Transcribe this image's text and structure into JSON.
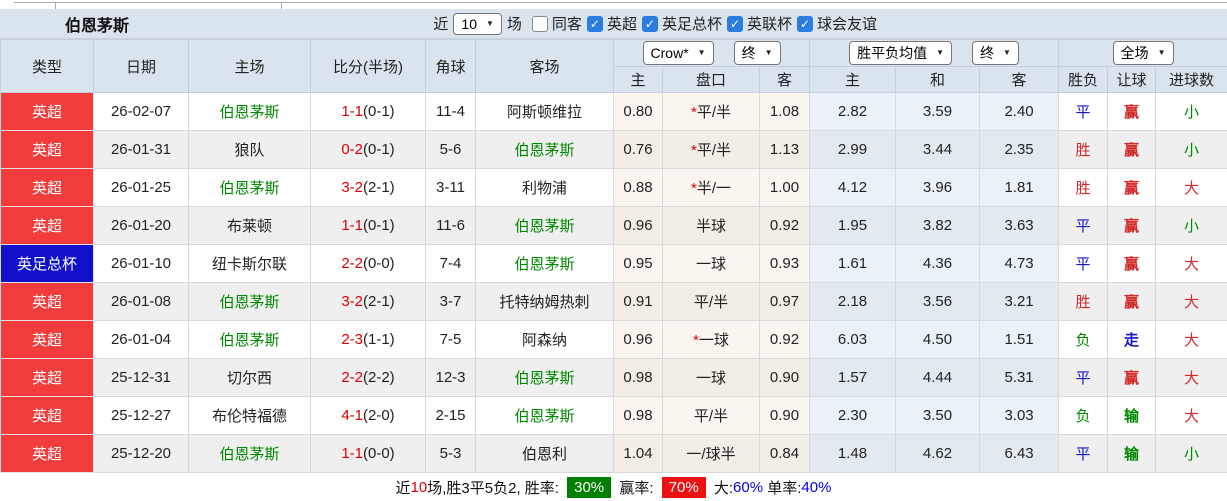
{
  "title": "伯恩茅斯",
  "filters": {
    "near_label": "近",
    "matches_value": "10",
    "matches_label": "场",
    "checkboxes": [
      {
        "label": "同客",
        "checked": false
      },
      {
        "label": "英超",
        "checked": true
      },
      {
        "label": "英足总杯",
        "checked": true
      },
      {
        "label": "英联杯",
        "checked": true
      },
      {
        "label": "球会友谊",
        "checked": true
      }
    ]
  },
  "header": {
    "selects": {
      "odds_company": "Crow*",
      "odds_final": "终",
      "avg": "胜平负均值",
      "avg_final": "终",
      "fullmatch": "全场"
    },
    "columns_main": [
      "类型",
      "日期",
      "主场",
      "比分(半场)",
      "角球",
      "客场"
    ],
    "columns_sub": [
      "主",
      "盘口",
      "客",
      "主",
      "和",
      "客",
      "胜负",
      "让球",
      "进球数"
    ]
  },
  "rows": [
    {
      "type": "英超",
      "type_color": "red",
      "date": "26-02-07",
      "home": "伯恩茅斯",
      "home_self": true,
      "score": "1-1",
      "half": "(0-1)",
      "corners": "11-4",
      "away": "阿斯顿维拉",
      "away_self": false,
      "crow": {
        "home": "0.80",
        "star": true,
        "handicap": "平/半",
        "away": "1.08"
      },
      "avg": {
        "home": "2.82",
        "draw": "3.59",
        "away": "2.40"
      },
      "result": {
        "text": "平",
        "color": "blue"
      },
      "handicap_result": {
        "text": "赢",
        "color": "red"
      },
      "goals": {
        "text": "小",
        "color": "green"
      }
    },
    {
      "type": "英超",
      "type_color": "red",
      "date": "26-01-31",
      "home": "狼队",
      "home_self": false,
      "score": "0-2",
      "half": "(0-1)",
      "corners": "5-6",
      "away": "伯恩茅斯",
      "away_self": true,
      "crow": {
        "home": "0.76",
        "star": true,
        "handicap": "平/半",
        "away": "1.13"
      },
      "avg": {
        "home": "2.99",
        "draw": "3.44",
        "away": "2.35"
      },
      "result": {
        "text": "胜",
        "color": "red"
      },
      "handicap_result": {
        "text": "赢",
        "color": "red"
      },
      "goals": {
        "text": "小",
        "color": "green"
      }
    },
    {
      "type": "英超",
      "type_color": "red",
      "date": "26-01-25",
      "home": "伯恩茅斯",
      "home_self": true,
      "score": "3-2",
      "half": "(2-1)",
      "corners": "3-11",
      "away": "利物浦",
      "away_self": false,
      "crow": {
        "home": "0.88",
        "star": true,
        "handicap": "半/一",
        "away": "1.00"
      },
      "avg": {
        "home": "4.12",
        "draw": "3.96",
        "away": "1.81"
      },
      "result": {
        "text": "胜",
        "color": "red"
      },
      "handicap_result": {
        "text": "赢",
        "color": "red"
      },
      "goals": {
        "text": "大",
        "color": "red"
      }
    },
    {
      "type": "英超",
      "type_color": "red",
      "date": "26-01-20",
      "home": "布莱顿",
      "home_self": false,
      "score": "1-1",
      "half": "(0-1)",
      "corners": "11-6",
      "away": "伯恩茅斯",
      "away_self": true,
      "crow": {
        "home": "0.96",
        "star": false,
        "handicap": "半球",
        "away": "0.92"
      },
      "avg": {
        "home": "1.95",
        "draw": "3.82",
        "away": "3.63"
      },
      "result": {
        "text": "平",
        "color": "blue"
      },
      "handicap_result": {
        "text": "赢",
        "color": "red"
      },
      "goals": {
        "text": "小",
        "color": "green"
      }
    },
    {
      "type": "英足总杯",
      "type_color": "blue",
      "date": "26-01-10",
      "home": "纽卡斯尔联",
      "home_self": false,
      "score": "2-2",
      "half": "(0-0)",
      "corners": "7-4",
      "away": "伯恩茅斯",
      "away_self": true,
      "crow": {
        "home": "0.95",
        "star": false,
        "handicap": "一球",
        "away": "0.93"
      },
      "avg": {
        "home": "1.61",
        "draw": "4.36",
        "away": "4.73"
      },
      "result": {
        "text": "平",
        "color": "blue"
      },
      "handicap_result": {
        "text": "赢",
        "color": "red"
      },
      "goals": {
        "text": "大",
        "color": "red"
      }
    },
    {
      "type": "英超",
      "type_color": "red",
      "date": "26-01-08",
      "home": "伯恩茅斯",
      "home_self": true,
      "score": "3-2",
      "half": "(2-1)",
      "corners": "3-7",
      "away": "托特纳姆热刺",
      "away_self": false,
      "crow": {
        "home": "0.91",
        "star": false,
        "handicap": "平/半",
        "away": "0.97"
      },
      "avg": {
        "home": "2.18",
        "draw": "3.56",
        "away": "3.21"
      },
      "result": {
        "text": "胜",
        "color": "red"
      },
      "handicap_result": {
        "text": "赢",
        "color": "red"
      },
      "goals": {
        "text": "大",
        "color": "red"
      }
    },
    {
      "type": "英超",
      "type_color": "red",
      "date": "26-01-04",
      "home": "伯恩茅斯",
      "home_self": true,
      "score": "2-3",
      "half": "(1-1)",
      "corners": "7-5",
      "away": "阿森纳",
      "away_self": false,
      "crow": {
        "home": "0.96",
        "star": true,
        "handicap": "一球",
        "away": "0.92"
      },
      "avg": {
        "home": "6.03",
        "draw": "4.50",
        "away": "1.51"
      },
      "result": {
        "text": "负",
        "color": "green"
      },
      "handicap_result": {
        "text": "走",
        "color": "blue"
      },
      "goals": {
        "text": "大",
        "color": "red"
      }
    },
    {
      "type": "英超",
      "type_color": "red",
      "date": "25-12-31",
      "home": "切尔西",
      "home_self": false,
      "score": "2-2",
      "half": "(2-2)",
      "corners": "12-3",
      "away": "伯恩茅斯",
      "away_self": true,
      "crow": {
        "home": "0.98",
        "star": false,
        "handicap": "一球",
        "away": "0.90"
      },
      "avg": {
        "home": "1.57",
        "draw": "4.44",
        "away": "5.31"
      },
      "result": {
        "text": "平",
        "color": "blue"
      },
      "handicap_result": {
        "text": "赢",
        "color": "red"
      },
      "goals": {
        "text": "大",
        "color": "red"
      }
    },
    {
      "type": "英超",
      "type_color": "red",
      "date": "25-12-27",
      "home": "布伦特福德",
      "home_self": false,
      "score": "4-1",
      "half": "(2-0)",
      "corners": "2-15",
      "away": "伯恩茅斯",
      "away_self": true,
      "crow": {
        "home": "0.98",
        "star": false,
        "handicap": "平/半",
        "away": "0.90"
      },
      "avg": {
        "home": "2.30",
        "draw": "3.50",
        "away": "3.03"
      },
      "result": {
        "text": "负",
        "color": "green"
      },
      "handicap_result": {
        "text": "输",
        "color": "green"
      },
      "goals": {
        "text": "大",
        "color": "red"
      }
    },
    {
      "type": "英超",
      "type_color": "red",
      "date": "25-12-20",
      "home": "伯恩茅斯",
      "home_self": true,
      "score": "1-1",
      "half": "(0-0)",
      "corners": "5-3",
      "away": "伯恩利",
      "away_self": false,
      "crow": {
        "home": "1.04",
        "star": false,
        "handicap": "一/球半",
        "away": "0.84"
      },
      "avg": {
        "home": "1.48",
        "draw": "4.62",
        "away": "6.43"
      },
      "result": {
        "text": "平",
        "color": "blue"
      },
      "handicap_result": {
        "text": "输",
        "color": "green"
      },
      "goals": {
        "text": "小",
        "color": "green"
      }
    }
  ],
  "footer": {
    "parts": [
      {
        "text": "近",
        "style": "plain"
      },
      {
        "text": "10",
        "style": "red"
      },
      {
        "text": "场,胜3平5负2, 胜率: ",
        "style": "plain"
      },
      {
        "text": "30%",
        "style": "badge-green"
      },
      {
        "text": " 赢率: ",
        "style": "plain"
      },
      {
        "text": "70%",
        "style": "badge-red"
      },
      {
        "text": " 大:",
        "style": "plain"
      },
      {
        "text": "60%",
        "style": "blue"
      },
      {
        "text": " 单率:",
        "style": "plain"
      },
      {
        "text": "40%",
        "style": "blue"
      }
    ]
  }
}
